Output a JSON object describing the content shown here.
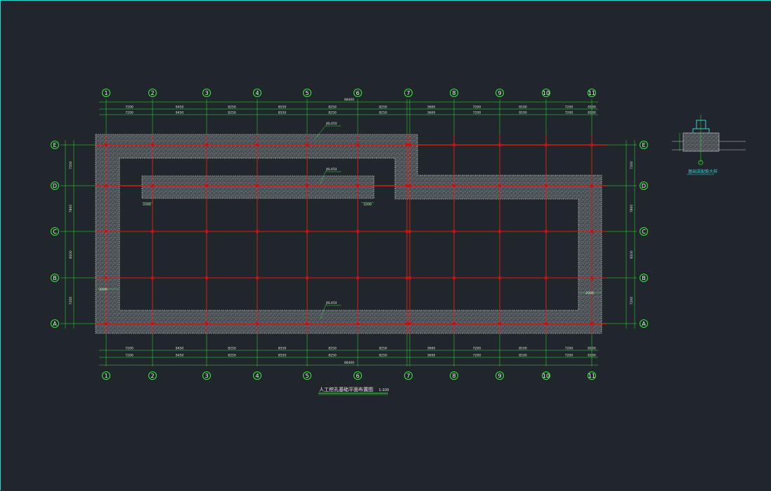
{
  "drawing": {
    "title": "人工挖孔基础平面布置图",
    "scale": "1:100",
    "detail_title": "基础梁配筋大样"
  },
  "axes_x": [
    "1",
    "2",
    "3",
    "4",
    "5",
    "6",
    "7",
    "7",
    "8",
    "9",
    "10",
    "11"
  ],
  "axes_y": [
    "E",
    "D",
    "C",
    "B",
    "A"
  ],
  "dims_top_row1": [
    "7200",
    "9450",
    "8250",
    "8550",
    "8250",
    "8250",
    "3600",
    "7200",
    "8100",
    "7200",
    "8100"
  ],
  "dims_top_row2": [
    "7200",
    "9450",
    "8250",
    "8550",
    "8250",
    "8250",
    "3600",
    "7200",
    "8100",
    "7200",
    "8100"
  ],
  "dims_top_total": "86400",
  "dims_bottom_row1": [
    "7200",
    "9450",
    "8250",
    "8550",
    "8250",
    "8250",
    "3600",
    "7200",
    "8100",
    "7200",
    "8100"
  ],
  "dims_bottom_row2": [
    "7200",
    "9450",
    "8250",
    "8550",
    "8250",
    "8250",
    "3600",
    "7200",
    "8100",
    "7200",
    "8100"
  ],
  "dims_bottom_total": "86400",
  "dims_left": [
    "7200",
    "7800",
    "8100",
    "7200"
  ],
  "dims_right": [
    "7200",
    "7800",
    "8100",
    "7200"
  ],
  "annotations": {
    "beam_top": "JKL450",
    "beam_mid": "JKL450",
    "beam_bottom": "JKL450",
    "offset_a": "2200",
    "offset_b": "2200",
    "offset_c": "2200",
    "offset_d": "2200"
  },
  "colors": {
    "background": "#21262d",
    "axis": "#2ee62e",
    "column_line": "#e01818",
    "slab_fill": "#4a4f55",
    "outline": "#d0d0d0",
    "frame": "#2ad4d4"
  }
}
